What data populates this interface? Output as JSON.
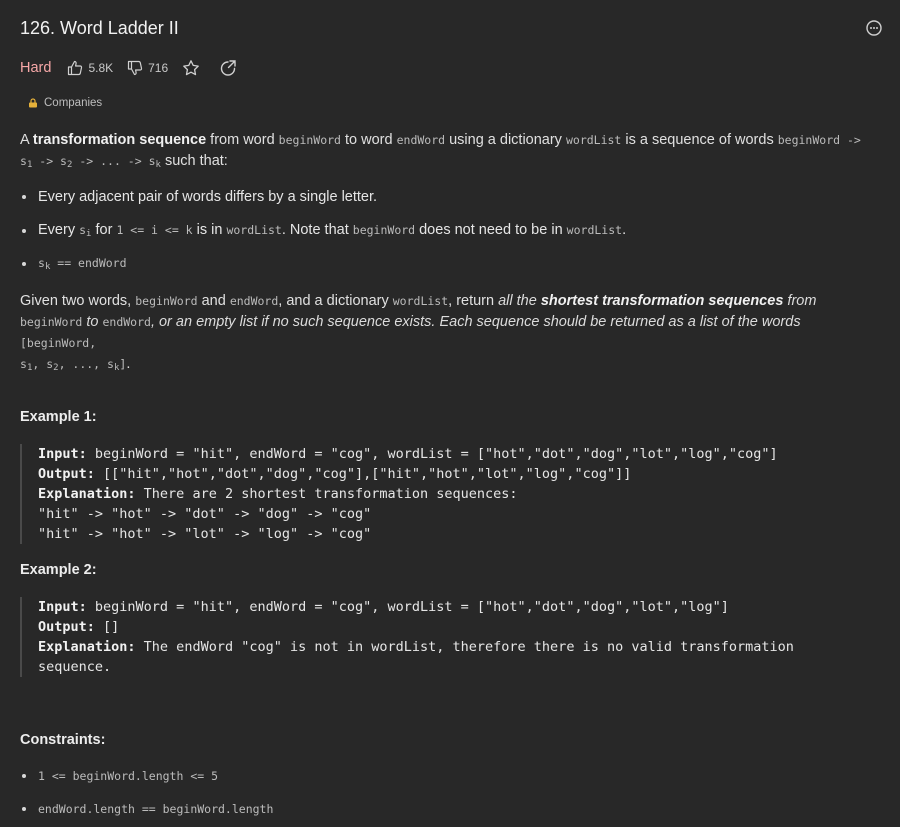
{
  "title": "126. Word Ladder II",
  "meta": {
    "difficulty": "Hard",
    "likes": "5.8K",
    "dislikes": "716"
  },
  "companies_label": "Companies",
  "intro": {
    "a": "A ",
    "b1": "transformation sequence",
    "t1": " from word ",
    "c1": "beginWord",
    "t2": " to word ",
    "c2": "endWord",
    "t3": " using a dictionary ",
    "c3": "wordList",
    "t4": " is a sequence of words ",
    "c4": "beginWord ->",
    "c5a": "s",
    "c5b": "1",
    "c6": " -> s",
    "c6b": "2",
    "c7": " -> ... -> s",
    "c7b": "k",
    "t5": " such that:"
  },
  "bullets": {
    "b1": "Every adjacent pair of words differs by a single letter.",
    "b2a": "Every ",
    "b2s": "s",
    "b2si": "i",
    "b2b": " for ",
    "b2c": "1 <= i <= k",
    "b2d": " is in ",
    "b2e": "wordList",
    "b2f": ". Note that ",
    "b2g": "beginWord",
    "b2h": " does not need to be in ",
    "b2i": "wordList",
    "b2j": ".",
    "b3a": "s",
    "b3b": "k",
    "b3c": " == endWord"
  },
  "given": {
    "t1": "Given two words, ",
    "c1": "beginWord",
    "t2": " and ",
    "c2": "endWord",
    "t3": ", and a dictionary ",
    "c3": "wordList",
    "t4": ", return ",
    "i1": "all the ",
    "bi": "shortest transformation sequences",
    "i2": " from",
    "c4": "beginWord",
    "i3": " to ",
    "c5": "endWord",
    "i4": ", or an empty list if no such sequence exists. Each sequence should be returned as a list of the words ",
    "c6": "[beginWord,",
    "c7": "s",
    "c7b": "1",
    "c8": ", s",
    "c8b": "2",
    "c9": ", ..., s",
    "c9b": "k",
    "c10": "]",
    "end": "."
  },
  "example1": {
    "heading": "Example 1:",
    "input_label": "Input:",
    "input": " beginWord = \"hit\", endWord = \"cog\", wordList = [\"hot\",\"dot\",\"dog\",\"lot\",\"log\",\"cog\"]",
    "output_label": "Output:",
    "output": " [[\"hit\",\"hot\",\"dot\",\"dog\",\"cog\"],[\"hit\",\"hot\",\"lot\",\"log\",\"cog\"]]",
    "expl_label": "Explanation:",
    "expl": " There are 2 shortest transformation sequences:",
    "line1": "\"hit\" -> \"hot\" -> \"dot\" -> \"dog\" -> \"cog\"",
    "line2": "\"hit\" -> \"hot\" -> \"lot\" -> \"log\" -> \"cog\""
  },
  "example2": {
    "heading": "Example 2:",
    "input_label": "Input:",
    "input": " beginWord = \"hit\", endWord = \"cog\", wordList = [\"hot\",\"dot\",\"dog\",\"lot\",\"log\"]",
    "output_label": "Output:",
    "output": " []",
    "expl_label": "Explanation:",
    "expl": " The endWord \"cog\" is not in wordList, therefore there is no valid transformation",
    "expl2": "sequence."
  },
  "constraints": {
    "heading": "Constraints:",
    "c1": "1 <= beginWord.length <= 5",
    "c2": "endWord.length == beginWord.length"
  }
}
